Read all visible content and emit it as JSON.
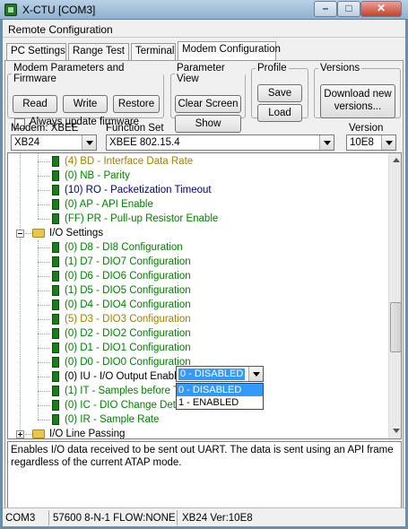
{
  "window": {
    "title": "X-CTU  [COM3]",
    "header": "Remote Configuration",
    "controls": {
      "minimize": "–",
      "maximize": "□",
      "close": "✕"
    }
  },
  "tabs": [
    {
      "label": "PC Settings",
      "active": false
    },
    {
      "label": "Range Test",
      "active": false
    },
    {
      "label": "Terminal",
      "active": false
    },
    {
      "label": "Modem Configuration",
      "active": true
    }
  ],
  "groups": {
    "firmware": {
      "legend": "Modem Parameters and Firmware",
      "read": "Read",
      "write": "Write",
      "restore": "Restore",
      "always_update": "Always update firmware",
      "always_update_checked": false
    },
    "view": {
      "legend": "Parameter View",
      "clear": "Clear Screen",
      "defaults": "Show Defaults"
    },
    "profile": {
      "legend": "Profile",
      "save": "Save",
      "load": "Load"
    },
    "versions": {
      "legend": "Versions",
      "download": "Download new versions..."
    }
  },
  "selectors": {
    "modem_label": "Modem: XBEE",
    "modem_value": "XB24",
    "funcset_label": "Function Set",
    "funcset_value": "XBEE 802.15.4",
    "version_label": "Version",
    "version_value": "10E8"
  },
  "tree": {
    "rows": [
      {
        "text": "(4) BD - Interface Data Rate",
        "color": "#a08000",
        "level": 2,
        "type": "param"
      },
      {
        "text": "(0) NB - Parity",
        "color": "#008000",
        "level": 2,
        "type": "param"
      },
      {
        "text": "(10) RO - Packetization Timeout",
        "color": "#000080",
        "level": 2,
        "type": "param"
      },
      {
        "text": "(0) AP - API Enable",
        "color": "#008000",
        "level": 2,
        "type": "param"
      },
      {
        "text": "(FF) PR - Pull-up Resistor Enable",
        "color": "#008000",
        "level": 2,
        "type": "param"
      },
      {
        "text": "I/O Settings",
        "color": "#000000",
        "level": 1,
        "type": "folder-open"
      },
      {
        "text": "(0) D8 - DI8 Configuration",
        "color": "#008000",
        "level": 2,
        "type": "param"
      },
      {
        "text": "(1) D7 - DIO7 Configuration",
        "color": "#008000",
        "level": 2,
        "type": "param"
      },
      {
        "text": "(0) D6 - DIO6 Configuration",
        "color": "#008000",
        "level": 2,
        "type": "param"
      },
      {
        "text": "(1) D5 - DIO5 Configuration",
        "color": "#008000",
        "level": 2,
        "type": "param"
      },
      {
        "text": "(0) D4 - DIO4 Configuration",
        "color": "#008000",
        "level": 2,
        "type": "param"
      },
      {
        "text": "(5) D3 - DIO3 Configuration",
        "color": "#a08000",
        "level": 2,
        "type": "param"
      },
      {
        "text": "(0) D2 - DIO2 Configuration",
        "color": "#008000",
        "level": 2,
        "type": "param"
      },
      {
        "text": "(0) D1 - DIO1 Configuration",
        "color": "#008000",
        "level": 2,
        "type": "param"
      },
      {
        "text": "(0) D0 - DIO0 Configuration",
        "color": "#008000",
        "level": 2,
        "type": "param"
      },
      {
        "text": "(0) IU - I/O Output Enable",
        "color": "#000000",
        "level": 2,
        "type": "param"
      },
      {
        "text": "(1) IT - Samples before TX",
        "color": "#008000",
        "level": 2,
        "type": "param"
      },
      {
        "text": "(0) IC - DIO Change Detect",
        "color": "#008000",
        "level": 2,
        "type": "param"
      },
      {
        "text": "(0) IR - Sample Rate",
        "color": "#008000",
        "level": 2,
        "type": "param"
      },
      {
        "text": "I/O Line Passing",
        "color": "#000000",
        "level": 1,
        "type": "folder-closed"
      }
    ],
    "iu_dropdown": {
      "value": "0 - DISABLED",
      "options": [
        "0 - DISABLED",
        "1 - ENABLED"
      ],
      "selected_index": 0
    }
  },
  "description": "Enables I/O data received to be sent out UART. The data is sent using an API frame regardless of the current ATAP mode.",
  "status": {
    "port": "COM3",
    "settings": "57600 8-N-1  FLOW:NONE",
    "modem": "XB24  Ver:10E8"
  }
}
